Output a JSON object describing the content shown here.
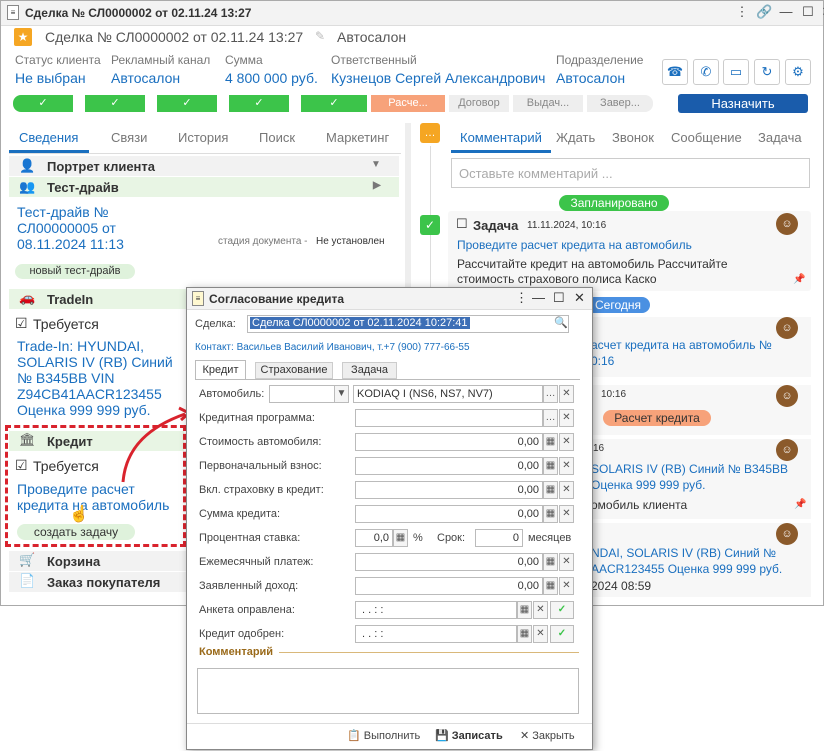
{
  "window": {
    "title": "Сделка № СЛ0000002 от 02.11.24 13:27",
    "header_title": "Сделка № СЛ0000002 от 02.11.24 13:27",
    "header_tag": "Автосалон"
  },
  "fields": [
    {
      "label": "Статус клиента",
      "value": "Не выбран"
    },
    {
      "label": "Рекламный канал",
      "value": "Автосалон"
    },
    {
      "label": "Сумма",
      "value": "4 800 000 руб."
    },
    {
      "label": "Ответственный",
      "value": "Кузнецов Сергей Александрович"
    },
    {
      "label": "Подразделение",
      "value": "Автосалон"
    }
  ],
  "stages": {
    "current": "Расче...",
    "next": [
      "Договор",
      "Выдач...",
      "Завер..."
    ],
    "assign_button": "Назначить"
  },
  "colors": {
    "accent": "#1a6fbf",
    "green": "#3cc44a",
    "orange": "#f7a27a",
    "red": "#d9232d"
  },
  "left_tabs": [
    "Сведения",
    "Связи",
    "История",
    "Поиск",
    "Маркетинг"
  ],
  "left": {
    "portrait": "Портрет клиента",
    "testdrive": "Тест-драйв",
    "testdrive_link": "Тест-драйв № СЛ00000005 от 08.11.2024 11:13",
    "doc_stage_label": "стадия документа -",
    "doc_stage_value": "Не установлен",
    "new_testdrive": "новый тест-драйв",
    "tradein": "TradeIn",
    "required1": "Требуется",
    "tradein_link": "Trade-In: HYUNDAI, SOLARIS IV (RB) Синий № В345ВВ VIN Z94CB41AACR123455 Оценка 999 999 руб.",
    "credit": "Кредит",
    "required2": "Требуется",
    "credit_link": "Проведите расчет кредита на автомобиль",
    "create_task": "создать задачу",
    "cart": "Корзина",
    "order": "Заказ покупателя"
  },
  "right_tabs": [
    "Комментарий",
    "Ждать",
    "Звонок",
    "Сообщение",
    "Задача"
  ],
  "right": {
    "comment_placeholder": "Оставьте комментарий ...",
    "planned": "Запланировано",
    "task_label": "Задача",
    "task_date": "11.11.2024, 10:16",
    "task_link": "Проведите расчет кредита на автомобиль",
    "task_desc": "Рассчитайте кредит на автомобиль Рассчитайте стоимость страхового полиса Каско",
    "today": "Сегодня",
    "item2_link": "асчет кредита на автомобиль № 0:16",
    "item3_date": "10:16",
    "item3_badge": "Расчет кредита",
    "item4_date": "16",
    "item4_text": "SOLARIS IV (RB) Синий № В345ВВ Оценка 999 999 руб.",
    "item4_sub": "омобиль клиента",
    "item5_text": "NDAI, SOLARIS IV (RB) Синий № AACR123455 Оценка 999 999 руб.",
    "item5_date": "2024 08:59"
  },
  "modal": {
    "title": "Согласование кредита",
    "deal_label": "Сделка:",
    "deal_value": "Сделка СЛ0000002 от 02.11.2024 10:27:41",
    "contact": "Контакт: Васильев Василий Иванович, т.+7 (900) 777-66-55",
    "tabs": [
      "Кредит",
      "Страхование",
      "Задача"
    ],
    "car_label": "Автомобиль:",
    "car_value": "KODIAQ I (NS6, NS7, NV7)",
    "program_label": "Кредитная программа:",
    "rows": [
      {
        "label": "Стоимость автомобиля:",
        "value": "0,00"
      },
      {
        "label": "Первоначальный взнос:",
        "value": "0,00"
      },
      {
        "label": "Вкл. страховку в кредит:",
        "value": "0,00"
      },
      {
        "label": "Сумма кредита:",
        "value": "0,00"
      }
    ],
    "rate_label": "Процентная ставка:",
    "rate_value": "0,0",
    "percent": "%",
    "term_label": "Срок:",
    "term_value": "0",
    "term_unit": "месяцев",
    "rows2": [
      {
        "label": "Ежемесячный платеж:",
        "value": "0,00"
      },
      {
        "label": "Заявленный доход:",
        "value": "0,00"
      }
    ],
    "form_label": "Анкета оправлена:",
    "form_value": " .  .      :  :",
    "approved_label": "Кредит одобрен:",
    "approved_value": " .  .      :  :",
    "comment_label": "Комментарий",
    "btn_execute": "Выполнить",
    "btn_save": "Записать",
    "btn_close": "Закрыть"
  }
}
